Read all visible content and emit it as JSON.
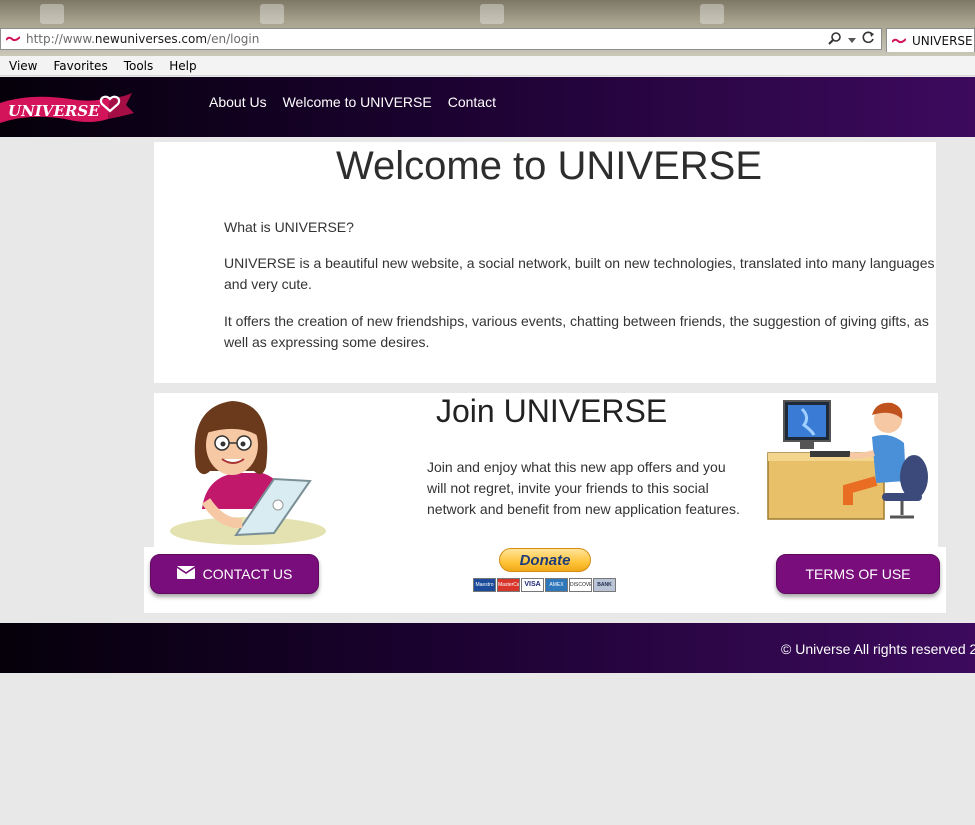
{
  "browser": {
    "url_prefix": "http://www.",
    "url_domain": "newuniverses.com",
    "url_path": "/en/login",
    "tab_title": "UNIVERSE",
    "menu": [
      "View",
      "Favorites",
      "Tools",
      "Help"
    ]
  },
  "site": {
    "logo_text": "UNIVERSE",
    "nav": [
      "About Us",
      "Welcome to UNIVERSE",
      "Contact"
    ]
  },
  "welcome": {
    "title": "Welcome to UNIVERSE",
    "question": "What is UNIVERSE?",
    "paragraph1": "UNIVERSE is a beautiful new website, a social network, built on new technologies, translated into many languages and very cute.",
    "paragraph2": "It offers the creation of new friendships, various events, chatting between friends, the suggestion of giving gifts, as well as expressing some desires."
  },
  "join": {
    "title": "Join UNIVERSE",
    "text": "Join and enjoy what this new app offers and you will not regret, invite your friends to this social network and benefit from new application features."
  },
  "actions": {
    "contact_label": "CONTACT US",
    "terms_label": "TERMS OF USE",
    "donate_label": "Donate",
    "cards": [
      "Maestro",
      "MasterCard",
      "VISA",
      "AMEX",
      "DISCOVER",
      "BANK"
    ]
  },
  "footer": {
    "copyright": "© Universe All rights reserved 2"
  },
  "colors": {
    "header_dark": "#05000a",
    "header_purple": "#3d0a5e",
    "button_purple": "#7a0d7c",
    "logo_pink": "#d4145a"
  }
}
